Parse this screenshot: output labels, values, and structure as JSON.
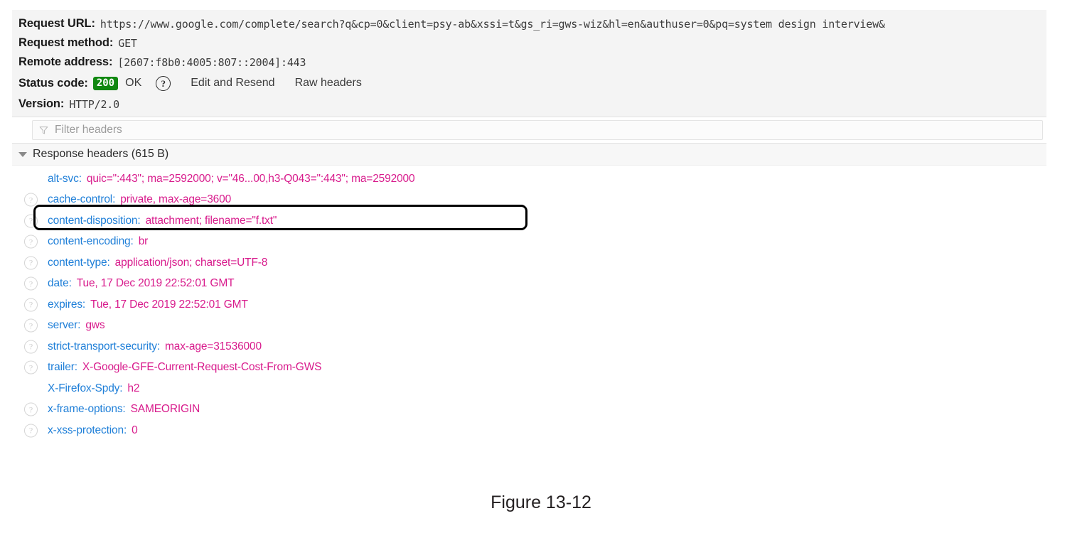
{
  "summary": {
    "request_url_label": "Request URL:",
    "request_url_value": "https://www.google.com/complete/search?q&cp=0&client=psy-ab&xssi=t&gs_ri=gws-wiz&hl=en&authuser=0&pq=system design interview&",
    "request_method_label": "Request method:",
    "request_method_value": "GET",
    "remote_address_label": "Remote address:",
    "remote_address_value": "[2607:f8b0:4005:807::2004]:443",
    "status_code_label": "Status code:",
    "status_code_value": "200",
    "status_code_text": "OK",
    "status_help_glyph": "?",
    "edit_and_resend_label": "Edit and Resend",
    "raw_headers_label": "Raw headers",
    "version_label": "Version:",
    "version_value": "HTTP/2.0",
    "status_badge_color": "#118811"
  },
  "filter": {
    "placeholder": "Filter headers",
    "value": ""
  },
  "group": {
    "title": "Response headers (615 B)"
  },
  "colors": {
    "header_name": "#1f7fd8",
    "header_value": "#d81b8c",
    "highlight_outline": "#000000"
  },
  "headers": [
    {
      "name": "alt-svc:",
      "value": "quic=\":443\"; ma=2592000; v=\"46...00,h3-Q043=\":443\"; ma=2592000",
      "help": false,
      "highlighted": false
    },
    {
      "name": "cache-control:",
      "value": "private, max-age=3600",
      "help": true,
      "highlighted": true
    },
    {
      "name": "content-disposition:",
      "value": "attachment; filename=\"f.txt\"",
      "help": true,
      "highlighted": false
    },
    {
      "name": "content-encoding:",
      "value": "br",
      "help": true,
      "highlighted": false
    },
    {
      "name": "content-type:",
      "value": "application/json; charset=UTF-8",
      "help": true,
      "highlighted": false
    },
    {
      "name": "date:",
      "value": "Tue, 17 Dec 2019 22:52:01 GMT",
      "help": true,
      "highlighted": false
    },
    {
      "name": "expires:",
      "value": "Tue, 17 Dec 2019 22:52:01 GMT",
      "help": true,
      "highlighted": false
    },
    {
      "name": "server:",
      "value": "gws",
      "help": true,
      "highlighted": false
    },
    {
      "name": "strict-transport-security:",
      "value": "max-age=31536000",
      "help": true,
      "highlighted": false
    },
    {
      "name": "trailer:",
      "value": "X-Google-GFE-Current-Request-Cost-From-GWS",
      "help": true,
      "highlighted": false
    },
    {
      "name": "X-Firefox-Spdy:",
      "value": "h2",
      "help": false,
      "highlighted": false
    },
    {
      "name": "x-frame-options:",
      "value": "SAMEORIGIN",
      "help": true,
      "highlighted": false
    },
    {
      "name": "x-xss-protection:",
      "value": "0",
      "help": true,
      "highlighted": false
    }
  ],
  "help_glyph": "?",
  "caption": "Figure 13-12"
}
